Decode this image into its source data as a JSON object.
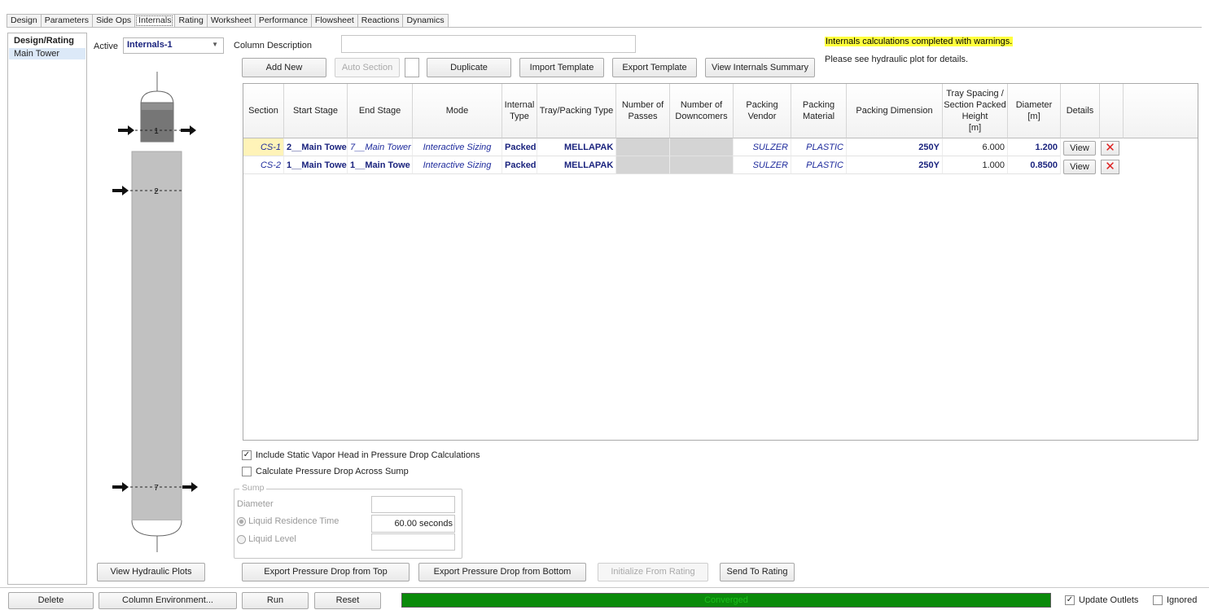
{
  "tabs": [
    "Design",
    "Parameters",
    "Side Ops",
    "Internals",
    "Rating",
    "Worksheet",
    "Performance",
    "Flowsheet",
    "Reactions",
    "Dynamics"
  ],
  "active_tab": "Internals",
  "nav": {
    "heading": "Design/Rating",
    "items": [
      "Main Tower"
    ]
  },
  "active": {
    "label": "Active",
    "value": "Internals-1"
  },
  "column_description": {
    "label": "Column Description",
    "value": ""
  },
  "toolbar": {
    "add_new": "Add New",
    "auto_section": "Auto Section",
    "duplicate": "Duplicate",
    "import_template": "Import Template",
    "export_template": "Export Template",
    "view_summary": "View Internals Summary"
  },
  "warning": {
    "line1": "Internals calculations completed with warnings.",
    "line2": "Please see hydraulic plot for details."
  },
  "table": {
    "headers": {
      "section": "Section",
      "start_stage": "Start Stage",
      "end_stage": "End Stage",
      "mode": "Mode",
      "internal_type": "Internal Type",
      "tray_packing_type": "Tray/Packing Type",
      "passes": "Number of Passes",
      "downcomers": "Number of Downcomers",
      "packing_vendor": "Packing Vendor",
      "packing_material": "Packing Material",
      "packing_dimension": "Packing Dimension",
      "tray_spacing": "Tray Spacing / Section Packed Height",
      "tray_spacing_unit": "[m]",
      "diameter": "Diameter",
      "diameter_unit": "[m]",
      "details": "Details"
    },
    "rows": [
      {
        "section": "CS-1",
        "start_stage": "2__Main Towe",
        "end_stage": "7__Main Tower",
        "mode": "Interactive Sizing",
        "internal_type": "Packed",
        "tray_packing_type": "MELLAPAK",
        "passes": "",
        "downcomers": "",
        "packing_vendor": "SULZER",
        "packing_material": "PLASTIC",
        "packing_dimension": "250Y",
        "tray_spacing": "6.000",
        "diameter": "1.200",
        "view": "View",
        "delete": "✕"
      },
      {
        "section": "CS-2",
        "start_stage": "1__Main Towe",
        "end_stage": "1__Main Towe",
        "mode": "Interactive Sizing",
        "internal_type": "Packed",
        "tray_packing_type": "MELLAPAK",
        "passes": "",
        "downcomers": "",
        "packing_vendor": "SULZER",
        "packing_material": "PLASTIC",
        "packing_dimension": "250Y",
        "tray_spacing": "1.000",
        "diameter": "0.8500",
        "view": "View",
        "delete": "✕"
      }
    ]
  },
  "column_diagram": {
    "stage_top": "1",
    "stage_mid": "2",
    "stage_bottom": "7"
  },
  "options": {
    "include_static": {
      "label": "Include Static Vapor Head in Pressure Drop Calculations",
      "checked": true,
      "mark": "✓"
    },
    "calc_sump": {
      "label": "Calculate Pressure Drop Across Sump",
      "checked": false
    }
  },
  "sump": {
    "title": "Sump",
    "diameter_label": "Diameter",
    "diameter_value": "",
    "residence_label": "Liquid Residence Time",
    "residence_value": "60.00 seconds",
    "level_label": "Liquid Level",
    "level_value": ""
  },
  "bottom_buttons": {
    "view_hydraulic": "View Hydraulic Plots",
    "export_top": "Export Pressure Drop from Top",
    "export_bottom": "Export Pressure Drop from Bottom",
    "init_rating": "Initialize From Rating",
    "send_rating": "Send To Rating"
  },
  "footer": {
    "delete": "Delete",
    "col_env": "Column Environment...",
    "run": "Run",
    "reset": "Reset",
    "status": "Converged",
    "update_outlets": "Update Outlets",
    "update_outlets_mark": "✓",
    "ignored": "Ignored"
  },
  "colors": {
    "status_green": "#0a8a0a",
    "status_text": "#1bbd1b",
    "warning_bg": "#ffff3c",
    "link_blue": "#1a237e",
    "nav_selected": "#dce9f8",
    "delete_red": "#d22222"
  }
}
